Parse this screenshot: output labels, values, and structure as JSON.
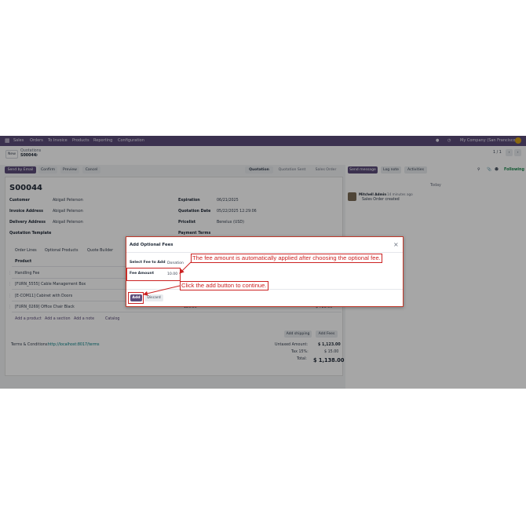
{
  "navbar": {
    "apps": "Sales",
    "menu": [
      "Orders",
      "To Invoice",
      "Products",
      "Reporting",
      "Configuration"
    ],
    "company": "My Company (San Francisco)"
  },
  "control": {
    "new_label": "New",
    "breadcrumb_parent": "Quotations",
    "breadcrumb_current": "S00044",
    "pager": "1 / 1"
  },
  "actions": {
    "send_email": "Send by Email",
    "confirm": "Confirm",
    "preview": "Preview",
    "cancel": "Cancel"
  },
  "statusbar": [
    "Quotation",
    "Quotation Sent",
    "Sales Order"
  ],
  "chatter": {
    "send_message": "Send message",
    "log_note": "Log note",
    "activities": "Activities",
    "following": "Following",
    "today": "Today",
    "author": "Mitchell Admin",
    "time": "14 minutes ago",
    "message": "Sales Order created"
  },
  "form": {
    "title": "S00044",
    "customer_label": "Customer",
    "customer": "Abigail Peterson",
    "invoice_label": "Invoice Address",
    "invoice": "Abigail Peterson",
    "delivery_label": "Delivery Address",
    "delivery": "Abigail Peterson",
    "template_label": "Quotation Template",
    "expiration_label": "Expiration",
    "expiration": "06/21/2025",
    "qdate_label": "Quotation Date",
    "qdate": "05/22/2025 12:29:06",
    "pricelist_label": "Pricelist",
    "pricelist": "Benelux (USD)",
    "payment_label": "Payment Terms"
  },
  "tabs": [
    "Order Lines",
    "Optional Products",
    "Quote Builder"
  ],
  "lines": {
    "header": "Product",
    "items": [
      {
        "name": "Handling Fee",
        "qty": "",
        "price": "",
        "total": ""
      },
      {
        "name": "[FURN_5555] Cable Management Box",
        "qty": "",
        "price": "",
        "total": ""
      },
      {
        "name": "[E-COM11] Cabinet with Doors",
        "qty": "",
        "price": "",
        "total": ""
      },
      {
        "name": "[FURN_0269] Office Chair Black",
        "qty": "",
        "price": "120.50",
        "total": "$ 723.00"
      }
    ],
    "add_product": "Add a product",
    "add_section": "Add a section",
    "add_note": "Add a note",
    "catalog": "Catalog",
    "add_shipping": "Add shipping",
    "add_fees": "Add Fees"
  },
  "totals": {
    "terms_label": "Terms & Conditions:",
    "terms_link": "http://localhost:8017/terms",
    "untaxed_label": "Untaxed Amount:",
    "untaxed": "$ 1,123.00",
    "tax_label": "Tax 15%:",
    "tax": "$ 15.00",
    "total_label": "Total:",
    "total": "$ 1,138.00"
  },
  "dialog": {
    "title": "Add Optional Fees",
    "fee_label": "Select Fee to Add",
    "fee_value": "Donation",
    "amount_label": "Fee Amount",
    "amount_value": "10.00",
    "add": "Add",
    "discard": "Discard"
  },
  "annotations": {
    "fee_note": "The fee amount is automatically applied after choosing the optional fee.",
    "add_note": "Click the add button to continue."
  },
  "colors": {
    "brand": "#5b4c7a",
    "annotation": "#cc2222",
    "following": "#1e8a4f"
  }
}
